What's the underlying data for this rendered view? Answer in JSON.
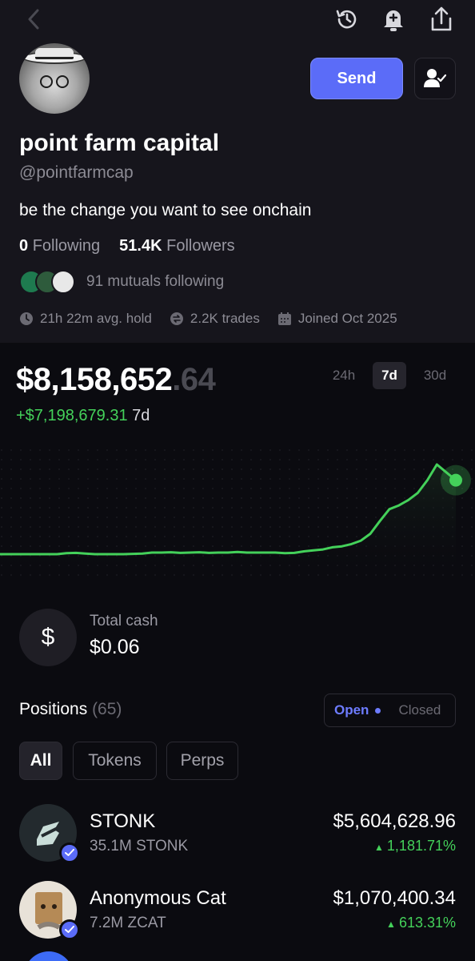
{
  "profile": {
    "name": "point farm capital",
    "handle": "@pointfarmcap",
    "bio": "be the change you want to see onchain",
    "following_count": "0",
    "following_label": "Following",
    "followers_count": "51.4K",
    "followers_label": "Followers",
    "mutuals_text": "91 mutuals following",
    "stats": {
      "avg_hold": "21h 22m avg. hold",
      "trades": "2.2K trades",
      "joined": "Joined Oct 2025"
    }
  },
  "actions": {
    "send_label": "Send"
  },
  "icons": {
    "back": "chevron-left-icon",
    "history": "history-icon",
    "notifications": "bell-plus-icon",
    "share": "share-icon",
    "follow": "user-check-icon"
  },
  "portfolio": {
    "balance_main": "$8,158,652",
    "balance_cents": ".64",
    "change_value": "+$7,198,679.31",
    "change_period": "7d",
    "timeframes": [
      "24h",
      "7d",
      "30d"
    ],
    "selected_timeframe": "7d"
  },
  "chart_data": {
    "type": "line",
    "series": [
      {
        "values": [
          0.0,
          0.0,
          0.0,
          0.0,
          0.0,
          0.0,
          0.0,
          0.3,
          0.4,
          0.2,
          0.0,
          0.0,
          0.0,
          0.0,
          0.1,
          0.2,
          0.5,
          0.5,
          0.6,
          0.4,
          0.5,
          0.6,
          0.4,
          0.5,
          0.5,
          0.7,
          0.5,
          0.5,
          0.5,
          0.5,
          0.3,
          0.4,
          0.9,
          1.2,
          1.5,
          2.2,
          2.5,
          3.2,
          4.3,
          6.5,
          10.5,
          14.3,
          15.5,
          17.2,
          19.5,
          23.5,
          28.5,
          26.0,
          23.5
        ]
      }
    ],
    "color": "#44d15a"
  },
  "cash": {
    "label": "Total cash",
    "value": "$0.06",
    "symbol": "$"
  },
  "positions": {
    "title": "Positions",
    "count": "(65)",
    "toggle_open": "Open",
    "toggle_closed": "Closed",
    "filters": [
      "All",
      "Tokens",
      "Perps"
    ],
    "items": [
      {
        "name": "STONK",
        "amount": "35.1M STONK",
        "value": "$5,604,628.96",
        "change": "1,181.71%"
      },
      {
        "name": "Anonymous Cat",
        "amount": "7.2M ZCAT",
        "value": "$1,070,400.34",
        "change": "613.31%"
      }
    ]
  }
}
